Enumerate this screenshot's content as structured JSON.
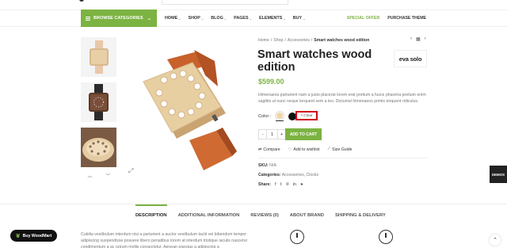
{
  "header": {
    "browse_label": "BROWSE CATEGORIES",
    "nav": [
      {
        "label": "HOME",
        "has_caret": true
      },
      {
        "label": "SHOP",
        "has_caret": true
      },
      {
        "label": "BLOG",
        "has_caret": true
      },
      {
        "label": "PAGES",
        "has_caret": true
      },
      {
        "label": "ELEMENTS",
        "has_caret": true
      },
      {
        "label": "BUY",
        "has_caret": true
      }
    ],
    "special_offer": "SPECIAL OFFER",
    "purchase_theme": "PURCHASE THEME"
  },
  "breadcrumb": {
    "home": "Home",
    "shop": "Shop",
    "accessories": "Accessories",
    "current": "Smart watches wood edition"
  },
  "product": {
    "title": "Smart watches wood edition",
    "brand_logo": "eva solo",
    "price": "$599.00",
    "description": "Himenaeos parturient nam a justo placerat lorem erat pretium a fusce pharetra pretium enim sagittis ut nunc neque torquent sem a leo. Dictumst himenaeos primis torquent ridiculus.",
    "color_label": "Color :",
    "clear_label": "Clear",
    "qty_minus": "-",
    "qty_value": "1",
    "qty_plus": "+",
    "add_to_cart": "ADD TO CART",
    "compare": "Compare",
    "wishlist": "Add to wishlist",
    "size_guide": "Size Guide",
    "sku_label": "SKU:",
    "sku_value": "N/A",
    "categories_label": "Categories:",
    "categories_value": "Accessories, Clocks",
    "share_label": "Share:"
  },
  "colors": {
    "accent": "#7cb342",
    "swatch_wood": "#f0d5a8",
    "swatch_black": "#111111",
    "highlight": "#d0021b"
  },
  "demos_label": "DEMOS",
  "tabs": [
    "DESCRIPTION",
    "ADDITIONAL INFORMATION",
    "REVIEWS (0)",
    "ABOUT BRAND",
    "SHIPPING & DELIVERY"
  ],
  "bottom_desc": "Cubilia vestibulum interdum nisi a parturient a auctor vestibulum taciti vel bibendum tempor adipiscing suspendisse posuere libero penatibus lorem at interdum tristique iaculis nascetur condimentum a ac rutrum mollis consectetur. Aenean egestas a adipiscing a",
  "buy_label": "Buy WoodMart",
  "icons": [
    "burger-icon",
    "chevron-down-icon",
    "grid-icon",
    "zoom-icon",
    "compare-icon",
    "heart-icon",
    "ruler-icon",
    "facebook-icon",
    "twitter-icon",
    "pinterest-icon",
    "linkedin-icon",
    "telegram-icon",
    "leaf-icon",
    "arrow-up-icon"
  ]
}
